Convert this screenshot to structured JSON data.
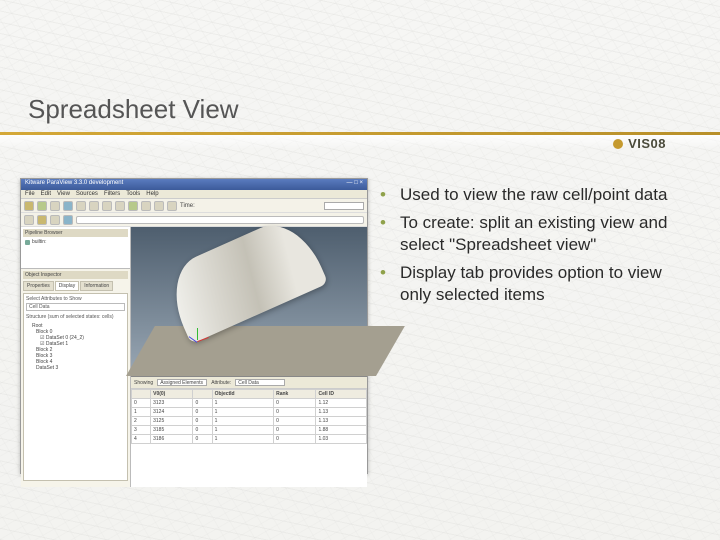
{
  "slide": {
    "title": "Spreadsheet View",
    "logo_text": "VIS08"
  },
  "bullets": [
    "Used to view the raw cell/point data",
    "To create: split an existing view and select \"Spreadsheet view\"",
    "Display tab provides option to view only selected items"
  ],
  "screenshot": {
    "window_title": "Kitware ParaView 3.3.0 development",
    "menu": [
      "File",
      "Edit",
      "View",
      "Sources",
      "Filters",
      "Tools",
      "Help"
    ],
    "time_label": "Time:",
    "pipeline": {
      "header": "Pipeline Browser",
      "root": "builtin:"
    },
    "inspector": {
      "header": "Object Inspector",
      "tabs": [
        "Properties",
        "Display",
        "Information"
      ],
      "active_tab": 1,
      "selection_label": "Select Attributes to Show",
      "selection_value": "Cell Data",
      "structure_label": "Structure (sum of selected states: cells)",
      "tree": [
        "Root",
        "Block 0",
        "☑ DataSet 0 (24_2)",
        "☑ DataSet 1",
        "Block 2",
        "Block 3",
        "Block 4",
        "DataSet 3"
      ]
    },
    "spreadsheet": {
      "ctrl_labels": [
        "Showing",
        "Attribute:"
      ],
      "ctrl_values": [
        "Assigned Elements",
        "Cell Data"
      ],
      "columns": [
        "",
        "V0(0)",
        "",
        "ObjectId",
        "Rank",
        "Cell ID"
      ],
      "rows": [
        [
          "0",
          "3123",
          "0",
          "1",
          "0",
          "1.12"
        ],
        [
          "1",
          "3124",
          "0",
          "1",
          "0",
          "1.13"
        ],
        [
          "2",
          "3125",
          "0",
          "1",
          "0",
          "1.13"
        ],
        [
          "3",
          "3185",
          "0",
          "1",
          "0",
          "1.88"
        ],
        [
          "4",
          "3186",
          "0",
          "1",
          "0",
          "1.03"
        ]
      ]
    }
  }
}
